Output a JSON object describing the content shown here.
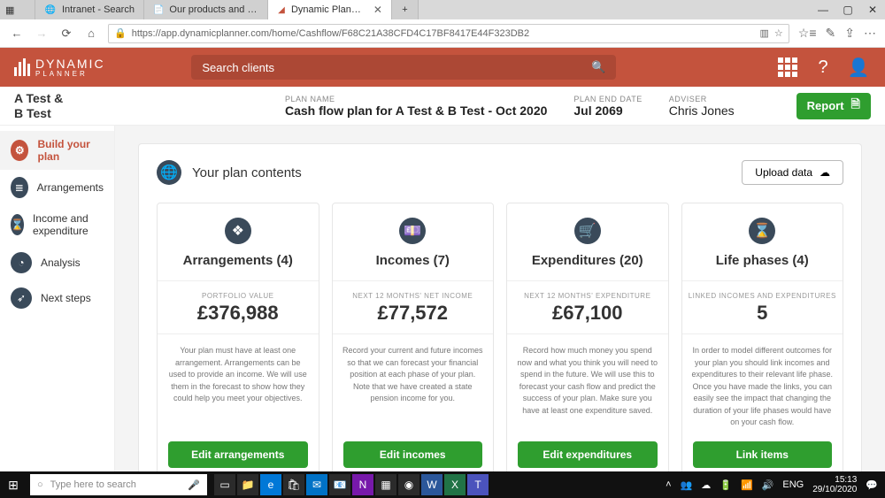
{
  "browser": {
    "tabs": [
      {
        "title": "Intranet - Search",
        "active": false
      },
      {
        "title": "Our products and services -",
        "active": false
      },
      {
        "title": "Dynamic Planner - Plan",
        "active": true
      }
    ],
    "url": "https://app.dynamicplanner.com/home/Cashflow/F68C21A38CFD4C17BF8417E44F323DB2"
  },
  "app": {
    "brand_top": "DYNAMIC",
    "brand_sub": "PLANNER",
    "search_placeholder": "Search clients"
  },
  "plan": {
    "client_line1": "A Test &",
    "client_line2": "B Test",
    "name_label": "PLAN NAME",
    "name_value": "Cash flow plan for A Test & B Test - Oct 2020",
    "end_label": "PLAN END DATE",
    "end_value": "Jul 2069",
    "adviser_label": "ADVISER",
    "adviser_value": "Chris Jones",
    "report_btn": "Report"
  },
  "sidebar": {
    "items": [
      {
        "label": "Build your plan",
        "name": "build-your-plan"
      },
      {
        "label": "Arrangements",
        "name": "arrangements"
      },
      {
        "label": "Income and expenditure",
        "name": "income-expenditure"
      },
      {
        "label": "Analysis",
        "name": "analysis"
      },
      {
        "label": "Next steps",
        "name": "next-steps"
      }
    ]
  },
  "contents": {
    "title": "Your plan contents",
    "upload_btn": "Upload data",
    "cards": [
      {
        "title": "Arrangements (4)",
        "stat_label": "PORTFOLIO VALUE",
        "stat_value": "£376,988",
        "desc": "Your plan must have at least one arrangement. Arrangements can be used to provide an income. We will use them in the forecast to show how they could help you meet your objectives.",
        "button": "Edit arrangements"
      },
      {
        "title": "Incomes (7)",
        "stat_label": "NEXT 12 MONTHS' NET INCOME",
        "stat_value": "£77,572",
        "desc": "Record your current and future incomes so that we can forecast your financial position at each phase of your plan. Note that we have created a state pension income for you.",
        "button": "Edit incomes"
      },
      {
        "title": "Expenditures (20)",
        "stat_label": "NEXT 12 MONTHS' EXPENDITURE",
        "stat_value": "£67,100",
        "desc": "Record how much money you spend now and what you think you will need to spend in the future. We will use this to forecast your cash flow and predict the success of your plan. Make sure you have at least one expenditure saved.",
        "button": "Edit expenditures"
      },
      {
        "title": "Life phases (4)",
        "stat_label": "LINKED INCOMES AND EXPENDITURES",
        "stat_value": "5",
        "desc": "In order to model different outcomes for your plan you should link incomes and expenditures to their relevant life phase. Once you have made the links, you can easily see the impact that changing the duration of your life phases would have on your cash flow.",
        "button": "Link items"
      }
    ]
  },
  "taskbar": {
    "search_placeholder": "Type here to search",
    "time": "15:13",
    "date": "29/10/2020"
  }
}
